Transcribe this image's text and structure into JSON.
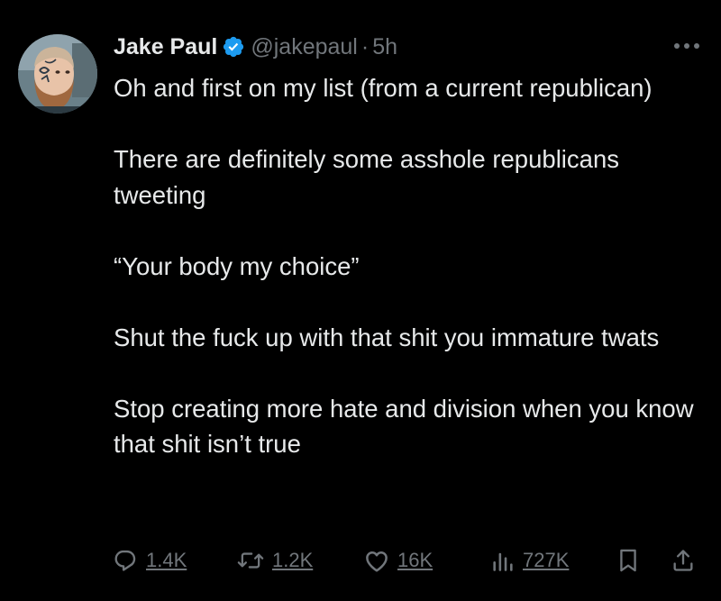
{
  "author": {
    "name": "Jake Paul",
    "handle": "@jakepaul",
    "separator": "·",
    "time": "5h"
  },
  "icons": {
    "verified": "verified-badge-icon",
    "more": "more-options-icon",
    "reply": "reply-icon",
    "retweet": "retweet-icon",
    "like": "like-icon",
    "views": "views-icon",
    "bookmark": "bookmark-icon",
    "share": "share-icon"
  },
  "tweet": {
    "paragraphs": [
      "Oh and first on my list (from a current republican)",
      "There are definitely some asshole republicans tweeting",
      "“Your body my choice”",
      "Shut the fuck up with that shit you immature twats",
      "Stop creating more hate and division when you know that shit isn’t true"
    ]
  },
  "stats": {
    "replies": "1.4K",
    "retweets": "1.2K",
    "likes": "16K",
    "views": "727K"
  },
  "colors": {
    "background": "#000000",
    "text": "#e7e9ea",
    "secondary": "#71767b",
    "verified": "#1d9bf0"
  }
}
